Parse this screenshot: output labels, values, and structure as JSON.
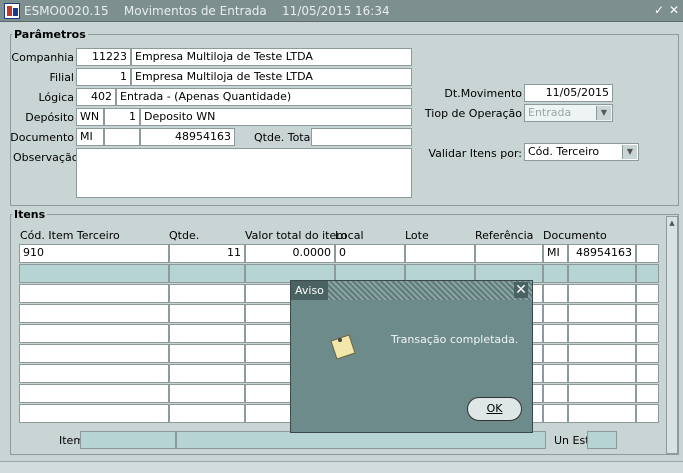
{
  "window": {
    "code": "ESMO0020.15",
    "title": "Movimentos de Entrada",
    "date_time": "11/05/2015 16:34",
    "minimize_glyph": "✓",
    "close_glyph": "✕"
  },
  "parametros": {
    "title": "Parâmetros",
    "companhia": {
      "label": "Companhia",
      "code": "11223",
      "name": "Empresa Multiloja de Teste LTDA"
    },
    "filial": {
      "label": "Filial",
      "code": "1",
      "name": "Empresa Multiloja de Teste LTDA"
    },
    "logica": {
      "label": "Lógica",
      "code": "402",
      "name": "Entrada - (Apenas Quantidade)"
    },
    "deposito": {
      "label": "Depósito",
      "type": "WN",
      "code": "1",
      "name": "Deposito WN"
    },
    "documento": {
      "label": "Documento",
      "serie": "MI",
      "extra": "",
      "number": "48954163"
    },
    "qtde_total": {
      "label": "Qtde. Total",
      "value": ""
    },
    "observacao": {
      "label": "Observação",
      "value": ""
    },
    "dt_movimento": {
      "label": "Dt.Movimento",
      "value": "11/05/2015"
    },
    "tipo_operacao": {
      "label": "Tiop de Operação",
      "value": "Entrada"
    },
    "validar_itens": {
      "label": "Validar Itens por:",
      "value": "Cód. Terceiro"
    }
  },
  "itens": {
    "title": "Itens",
    "columns": [
      "Cód. Item Terceiro",
      "Qtde.",
      "Valor total do item",
      "Local",
      "Lote",
      "Referência",
      "Documento"
    ],
    "row1": {
      "cod_item": "910",
      "qtde": "11",
      "valor_total": "0.0000",
      "local": "0",
      "lote": "",
      "referencia": "",
      "doc_serie": "MI",
      "doc_numero": "48954163"
    },
    "footer_item_label": "Item",
    "footer_un_est_label": "Un Est"
  },
  "dialog": {
    "title": "Aviso",
    "message": "Transação completada.",
    "ok_label": "OK",
    "close_glyph": "✕"
  },
  "colors": {
    "titlebar": "#7d8f8f",
    "background": "#c9d4d4",
    "selected_row": "#b6d4d4",
    "dialog": "#6e8b8b"
  }
}
